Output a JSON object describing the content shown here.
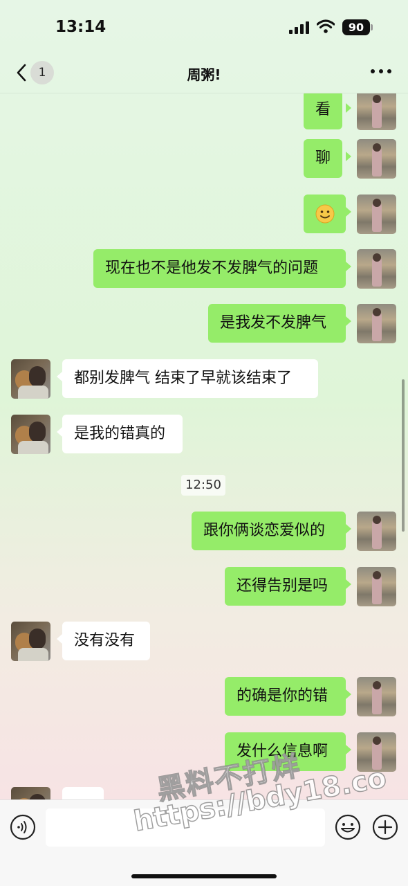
{
  "status_bar": {
    "time": "13:14",
    "battery": "90"
  },
  "nav": {
    "unread_count": "1",
    "title": "周粥!"
  },
  "timestamp": "12:50",
  "messages": [
    {
      "side": "self",
      "text": "看"
    },
    {
      "side": "self",
      "text": "聊"
    },
    {
      "side": "self",
      "text": "🙂"
    },
    {
      "side": "self",
      "text": "现在也不是他发不发脾气的问题"
    },
    {
      "side": "self",
      "text": "是我发不发脾气"
    },
    {
      "side": "other",
      "text": "都别发脾气 结束了早就该结束了"
    },
    {
      "side": "other",
      "text": "是我的错真的"
    },
    {
      "side": "self",
      "text": "跟你俩谈恋爱似的"
    },
    {
      "side": "self",
      "text": "还得告别是吗"
    },
    {
      "side": "other",
      "text": "没有没有"
    },
    {
      "side": "self",
      "text": "的确是你的错"
    },
    {
      "side": "self",
      "text": "发什么信息啊"
    },
    {
      "side": "other",
      "text": "."
    }
  ],
  "input": {
    "value": ""
  },
  "watermark": {
    "line1": "黑料不打烊",
    "line2": "https://bdy18.co"
  }
}
